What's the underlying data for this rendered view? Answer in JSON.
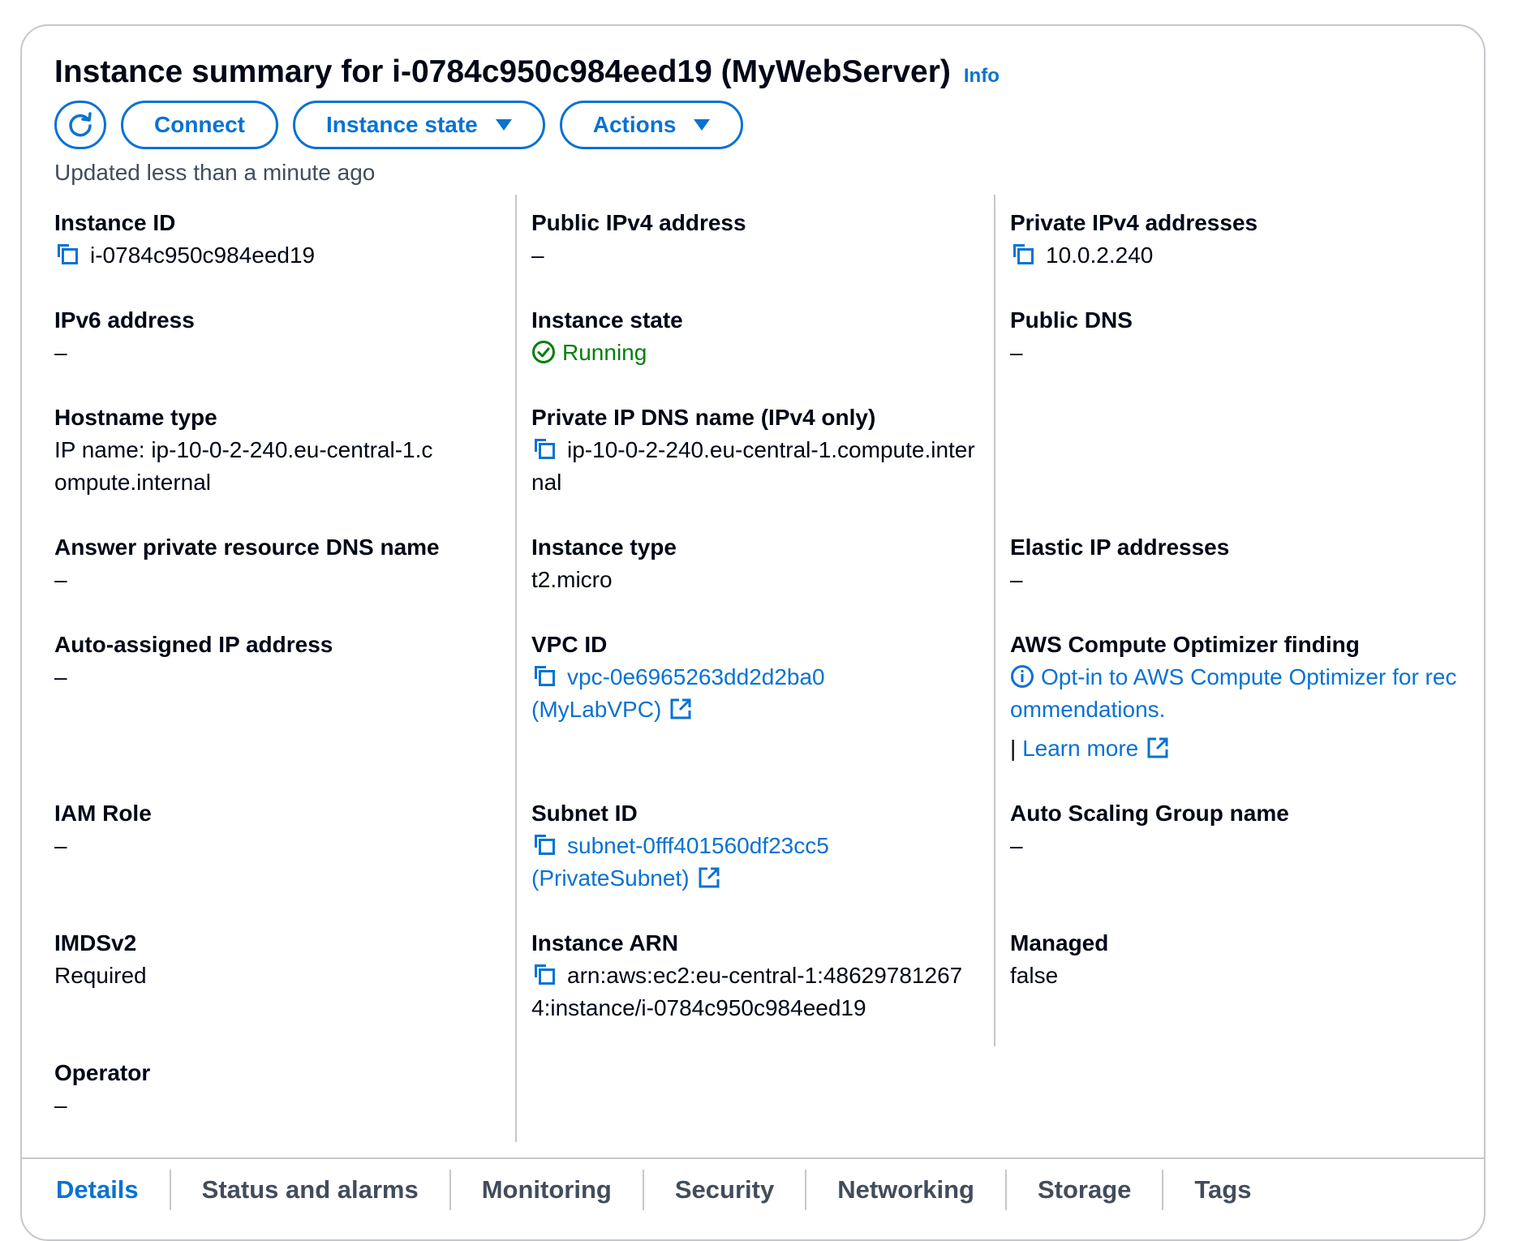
{
  "header": {
    "title": "Instance summary for i-0784c950c984eed19 (MyWebServer)",
    "info_label": "Info",
    "refresh_icon": "refresh-icon",
    "connect_label": "Connect",
    "instance_state_label": "Instance state",
    "actions_label": "Actions",
    "updated_text": "Updated less than a minute ago"
  },
  "fields": {
    "instance_id": {
      "label": "Instance ID",
      "value": "i-0784c950c984eed19"
    },
    "public_ipv4": {
      "label": "Public IPv4 address",
      "value": "–"
    },
    "private_ipv4": {
      "label": "Private IPv4 addresses",
      "value": "10.0.2.240"
    },
    "ipv6": {
      "label": "IPv6 address",
      "value": "–"
    },
    "instance_state": {
      "label": "Instance state",
      "value": "Running"
    },
    "public_dns": {
      "label": "Public DNS",
      "value": "–"
    },
    "hostname_type": {
      "label": "Hostname type",
      "value": "IP name: ip-10-0-2-240.eu-central-1.compute.internal"
    },
    "private_ip_dns": {
      "label": "Private IP DNS name (IPv4 only)",
      "value": "ip-10-0-2-240.eu-central-1.compute.internal"
    },
    "answer_dns": {
      "label": "Answer private resource DNS name",
      "value": "–"
    },
    "instance_type": {
      "label": "Instance type",
      "value": "t2.micro"
    },
    "elastic_ip": {
      "label": "Elastic IP addresses",
      "value": "–"
    },
    "auto_ip": {
      "label": "Auto-assigned IP address",
      "value": "–"
    },
    "vpc_id": {
      "label": "VPC ID",
      "value": "vpc-0e6965263dd2d2ba0",
      "value2": "(MyLabVPC)"
    },
    "optimizer": {
      "label": "AWS Compute Optimizer finding",
      "value": "Opt-in to AWS Compute Optimizer for recommendations.",
      "separator": "|",
      "learn_more": "Learn more"
    },
    "iam_role": {
      "label": "IAM Role",
      "value": "–"
    },
    "subnet_id": {
      "label": "Subnet ID",
      "value": "subnet-0fff401560df23cc5",
      "value2": "(PrivateSubnet)"
    },
    "asg_name": {
      "label": "Auto Scaling Group name",
      "value": "–"
    },
    "imdsv2": {
      "label": "IMDSv2",
      "value": "Required"
    },
    "instance_arn": {
      "label": "Instance ARN",
      "value": "arn:aws:ec2:eu-central-1:486297812674:instance/i-0784c950c984eed19"
    },
    "managed": {
      "label": "Managed",
      "value": "false"
    },
    "operator": {
      "label": "Operator",
      "value": "–"
    }
  },
  "tabs": [
    "Details",
    "Status and alarms",
    "Monitoring",
    "Security",
    "Networking",
    "Storage",
    "Tags"
  ],
  "colors": {
    "accent": "#0972d3",
    "success": "#037f0c",
    "border": "#c6c6cd",
    "text": "#000716"
  }
}
